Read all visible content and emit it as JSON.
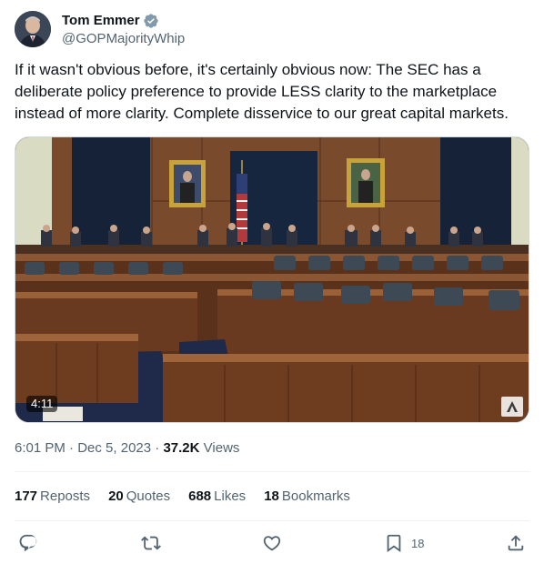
{
  "author": {
    "display_name": "Tom Emmer",
    "handle": "@GOPMajorityWhip",
    "verified": true,
    "badge_color": "#829aab"
  },
  "tweet": {
    "text": "If it wasn't obvious before, it's certainly obvious now: The SEC has a deliberate policy preference to provide LESS clarity to the marketplace instead of more clarity. Complete disservice to our great capital markets."
  },
  "media": {
    "type": "video",
    "duration": "4:11"
  },
  "meta": {
    "time": "6:01 PM",
    "separator": "·",
    "date": "Dec 5, 2023",
    "views_count": "37.2K",
    "views_label": "Views"
  },
  "stats": {
    "reposts": {
      "count": "177",
      "label": "Reposts"
    },
    "quotes": {
      "count": "20",
      "label": "Quotes"
    },
    "likes": {
      "count": "688",
      "label": "Likes"
    },
    "bookmarks": {
      "count": "18",
      "label": "Bookmarks"
    }
  },
  "actions": {
    "reply": {
      "icon": "reply-icon"
    },
    "repost": {
      "icon": "repost-icon"
    },
    "like": {
      "icon": "heart-icon"
    },
    "bookmark": {
      "icon": "bookmark-icon",
      "count": "18"
    },
    "share": {
      "icon": "share-icon"
    }
  },
  "colors": {
    "text_primary": "#0f1419",
    "text_secondary": "#536471",
    "divider": "#eff3f4"
  }
}
